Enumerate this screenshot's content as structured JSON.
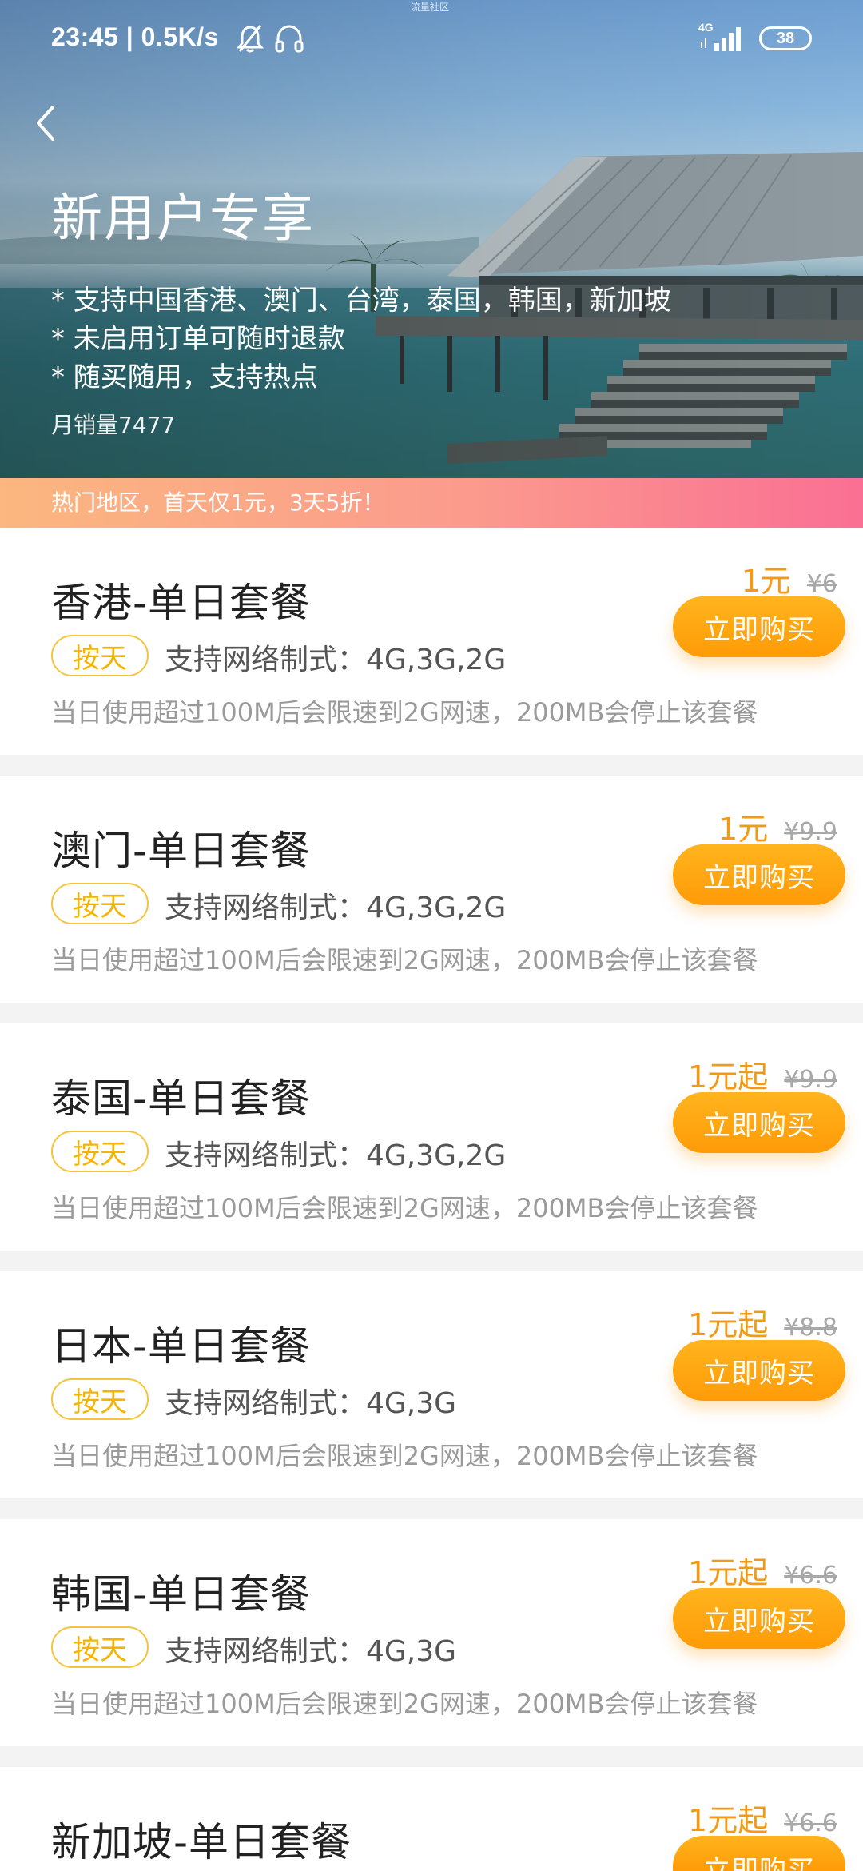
{
  "status_bar": {
    "time": "23:45 | 0.5K/s",
    "network_type": "4G",
    "battery": "38",
    "top_tiny": "流量社区"
  },
  "hero": {
    "title": "新用户专享",
    "features": [
      "* 支持中国香港、澳门、台湾，泰国，韩国，新加坡",
      "* 未启用订单可随时退款",
      "* 随买随用，支持热点"
    ],
    "sales": "月销量7477"
  },
  "promo": {
    "text": "热门地区，首天仅1元，3天5折！"
  },
  "buy_label": "立即购买",
  "tag_label": "按天",
  "packages": [
    {
      "title": "香港-单日套餐",
      "price": "1元",
      "old_price": "¥6",
      "network": "支持网络制式：4G,3G,2G",
      "limit": "当日使用超过100M后会限速到2G网速，200MB会停止该套餐"
    },
    {
      "title": "澳门-单日套餐",
      "price": "1元",
      "old_price": "¥9.9",
      "network": "支持网络制式：4G,3G,2G",
      "limit": "当日使用超过100M后会限速到2G网速，200MB会停止该套餐"
    },
    {
      "title": "泰国-单日套餐",
      "price": "1元起",
      "old_price": "¥9.9",
      "network": "支持网络制式：4G,3G,2G",
      "limit": "当日使用超过100M后会限速到2G网速，200MB会停止该套餐"
    },
    {
      "title": "日本-单日套餐",
      "price": "1元起",
      "old_price": "¥8.8",
      "network": "支持网络制式：4G,3G",
      "limit": "当日使用超过100M后会限速到2G网速，200MB会停止该套餐"
    },
    {
      "title": "韩国-单日套餐",
      "price": "1元起",
      "old_price": "¥6.6",
      "network": "支持网络制式：4G,3G",
      "limit": "当日使用超过100M后会限速到2G网速，200MB会停止该套餐"
    },
    {
      "title": "新加坡-单日套餐",
      "price": "1元起",
      "old_price": "¥6.6"
    }
  ],
  "colors": {
    "accent_orange": "#ff9b07",
    "price_orange": "#f39a14",
    "tag_yellow": "#f5c43a",
    "promo_start": "#fbb77f",
    "promo_end": "#fa6f94"
  }
}
